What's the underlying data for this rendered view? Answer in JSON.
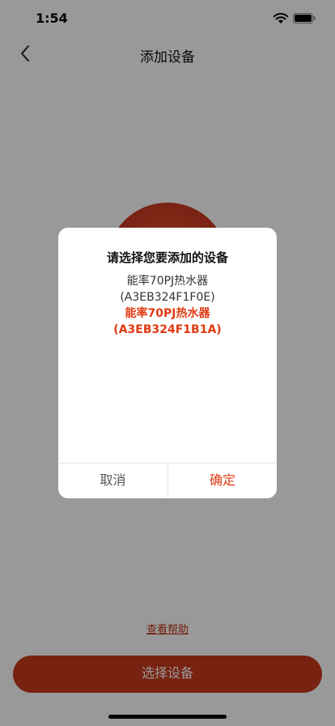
{
  "status_bar": {
    "time": "1:54"
  },
  "nav": {
    "title": "添加设备"
  },
  "content": {
    "help_link": "查看帮助"
  },
  "bottom": {
    "select_button": "选择设备"
  },
  "dialog": {
    "title": "请选择您要添加的设备",
    "devices": [
      {
        "name": "能率70PJ热水器",
        "id": "(A3EB324F1F0E)",
        "selected": false
      },
      {
        "name": "能率70PJ热水器",
        "id": "(A3EB324F1B1A)",
        "selected": true
      }
    ],
    "cancel_label": "取消",
    "confirm_label": "确定"
  },
  "colors": {
    "accent": "#e03a12",
    "button": "#c9391d"
  },
  "icons": {
    "back": "chevron-left-icon",
    "wifi": "wifi-icon",
    "battery": "battery-icon"
  }
}
